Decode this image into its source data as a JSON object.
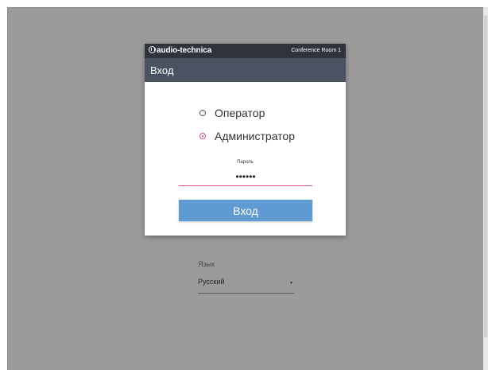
{
  "brand": {
    "logo_text": "audio-technica",
    "room_name": "Conference Room 1"
  },
  "dialog": {
    "title": "Вход",
    "roles": [
      {
        "label": "Оператор",
        "selected": false
      },
      {
        "label": "Администратор",
        "selected": true
      }
    ],
    "password_label": "Пароль",
    "password_value": "••••••",
    "login_label": "Вход"
  },
  "language": {
    "label": "Язык",
    "selected": "Русский",
    "caret": "▼"
  },
  "colors": {
    "brand_bar": "#2f343c",
    "title_bar": "#4a5361",
    "accent": "#d64a7b",
    "button": "#5f9ad3",
    "backdrop": "#9b9b9b"
  }
}
